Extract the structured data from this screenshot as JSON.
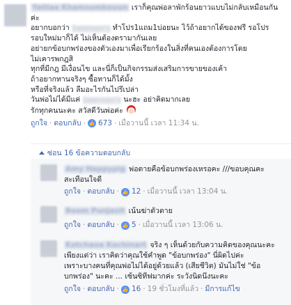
{
  "main_comment": {
    "author": "Yalilaa Khamsombouun",
    "lines": [
      "เราก็คุณพ่อลาพักร้อนยาวแบบไม่กลับเหมือนกัน",
      "ค่ะ",
      "อยากบอกว่า",
      "ทำโปร1แถม1บ่อยนะ ไว้ถ้าอยากได้ของฟรี รอโปร",
      "รอบใหม่มาก็ได้ ไม่เห็นต้องดรามากันเลย",
      "อย่ายกข้อบกพร่องของตัวเองมาเพื่อเรียกร้องในสิ่งที่คนเองต้องการโดย",
      "ไม่เคารพกฎสิ",
      "ทุกที่มีกฎ มีเงื่อนไข และนี่ก็เป็นกิจกรรมส่งเสริมการขายของเค้า",
      "ถ้าอยากทานจริงๆ ซื้อทานก็ได้มั้ง",
      "หรือที่จริงแล้ว ลืมอะไรกันไปรึเปล่า",
      "วันพ่อไม่ได้มีแค่",
      "นะฮะ อย่าคิดมากเลย",
      "รักทุกคนนะคะ สวัสดีวันพ่อค่ะ"
    ],
    "redacted_brand": "Swensen's",
    "meta": {
      "like": "ถูกใจ",
      "reply": "ตอบกลับ",
      "like_count": "673",
      "time": "เมื่อวานนี้ เวลา 11:34 น."
    }
  },
  "reply_toggle": {
    "label": "ซ่อน 16 ข้อความตอบกลับ"
  },
  "replies": [
    {
      "author": "Amy Happypig",
      "lines": [
        "พ่อตายคือข้อบกพร่องเหรอคะ ///ขอบคุณคะ",
        "สะเทือนใจดี"
      ],
      "like": "ถูกใจ",
      "reply": "ตอบกลับ",
      "like_count": "12",
      "time": "เมื่อวานนี้ เวลา 13:04 น."
    },
    {
      "author": "Boom Punjasit",
      "lines": [
        "เน้นฆ่าตัวตาย"
      ],
      "like": "ถูกใจ",
      "reply": "ตอบกลับ",
      "like_count": "5",
      "time": "เมื่อวานนี้ เวลา 13:06 น."
    },
    {
      "author": "Kotchaoa Kochinart",
      "lines": [
        "จริง ๆ เห็นด้วยกับความคิดของคุณนะคะ",
        "เพียงแต่ว่า เราคิดว่าคุณใช้คำพูด \"ข้อบกพร่อง\" นี่ผิดไปค่ะ",
        "เพราะบางคนที่คุณพ่อไม่ได้อยู่ด้วยแล้ว (เสียชีวิต) มันไม่ใช่ \"ข้อ",
        "บกพร่อง\" นะคะ ... เซ้นซิทีฟมากค่ะ ระวังนิดนึงนะคะ"
      ],
      "like": "ถูกใจ",
      "reply": "ตอบกลับ",
      "like_count": "16",
      "time": "19 ชั่วโมงที่แล้ว",
      "edited": "มีการแก้ไข"
    }
  ],
  "icons": {
    "like_badge": "thumbs-up-icon",
    "emoji": "santa-emoji-icon",
    "toggle": "caret-up-icon"
  },
  "colors": {
    "link": "#4267b2",
    "meta": "#90949c",
    "text": "#1d2129",
    "like_badge": "#5890ff"
  }
}
